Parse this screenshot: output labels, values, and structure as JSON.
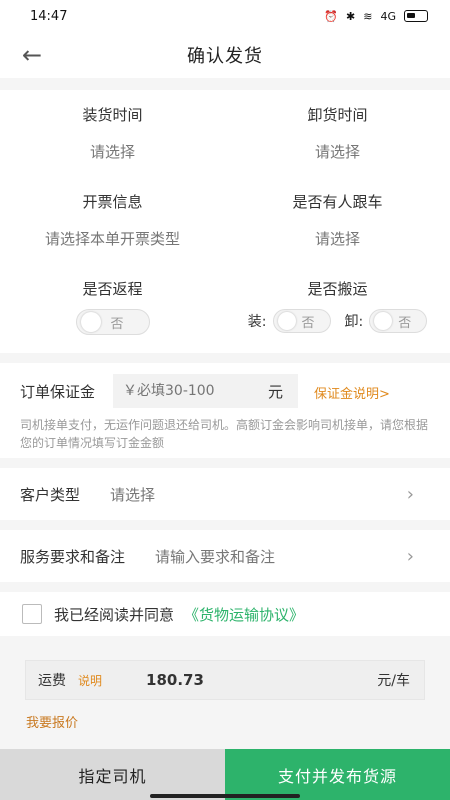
{
  "status": {
    "time": "14:47",
    "network": "4G"
  },
  "header": {
    "title": "确认发货"
  },
  "cells": {
    "load_time": {
      "label": "装货时间",
      "value": "请选择"
    },
    "unload_time": {
      "label": "卸货时间",
      "value": "请选择"
    },
    "invoice": {
      "label": "开票信息",
      "value": "请选择本单开票类型"
    },
    "escort": {
      "label": "是否有人跟车",
      "value": "请选择"
    },
    "return_trip": {
      "label": "是否返程",
      "toggle": "否"
    },
    "handling": {
      "label": "是否搬运",
      "load_label": "装:",
      "unload_label": "卸:",
      "load_toggle": "否",
      "unload_toggle": "否"
    }
  },
  "deposit": {
    "label": "订单保证金",
    "placeholder": "￥必填30-100",
    "unit": "元",
    "link": "保证金说明>",
    "desc": "司机接单支付，无运作问题退还给司机。高额订金会影响司机接单，请您根据您的订单情况填写订金金额"
  },
  "customer_type": {
    "label": "客户类型",
    "value": "请选择"
  },
  "service": {
    "label": "服务要求和备注",
    "placeholder": "请输入要求和备注"
  },
  "agreement": {
    "text": "我已经阅读并同意",
    "link": "《货物运输协议》"
  },
  "freight": {
    "label": "运费",
    "explain": "说明",
    "amount": "180.73",
    "unit": "元/车"
  },
  "quote_link": "我要报价",
  "buttons": {
    "assign_driver": "指定司机",
    "pay_publish": "支付并发布货源"
  },
  "colors": {
    "accent": "#2db36b",
    "orange": "#e08a1e"
  }
}
